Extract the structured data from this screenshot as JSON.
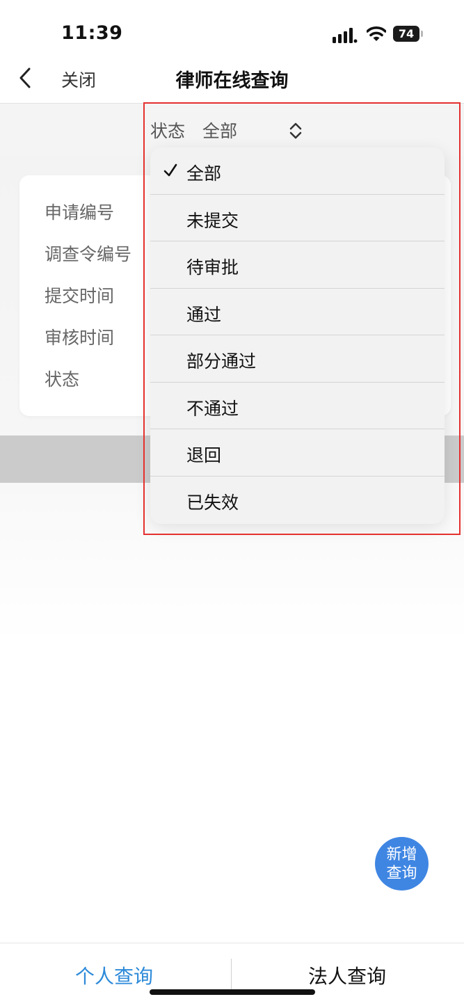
{
  "status_bar": {
    "time": "11:39",
    "battery": "74"
  },
  "nav": {
    "close_label": "关闭",
    "title": "律师在线查询"
  },
  "filter": {
    "label": "状态",
    "value": "全部"
  },
  "card": {
    "fields": [
      "申请编号",
      "调查令编号",
      "提交时间",
      "审核时间",
      "状态"
    ]
  },
  "dropdown": {
    "selected_index": 0,
    "options": [
      "全部",
      "未提交",
      "待审批",
      "通过",
      "部分通过",
      "不通过",
      "退回",
      "已失效"
    ]
  },
  "fab": {
    "line1": "新增",
    "line2": "查询"
  },
  "tabs": {
    "personal": "个人查询",
    "corporate": "法人查询"
  },
  "colors": {
    "accent": "#2d8ad9",
    "fab": "#3f86e3",
    "highlight": "#e53030"
  },
  "icons": [
    "signal-icon",
    "wifi-icon",
    "battery-icon",
    "back-chevron-icon",
    "sort-updown-icon",
    "checkmark-icon"
  ]
}
